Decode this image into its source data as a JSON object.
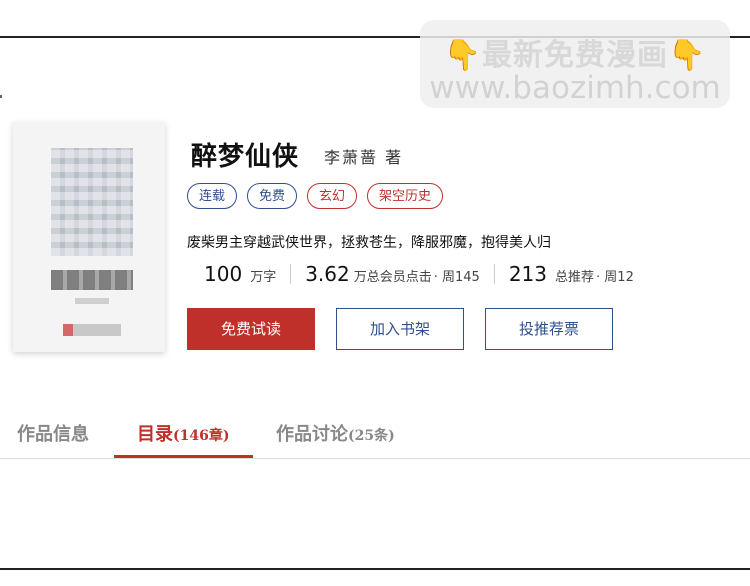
{
  "watermark": {
    "hand_left": "👇",
    "text": "最新免费漫画",
    "hand_right": "👇",
    "url": "www.baozimh.com"
  },
  "book": {
    "title": "醉梦仙侠",
    "author": "李萧蔷 著",
    "tags": [
      {
        "label": "连载",
        "color": "#2f4f8f"
      },
      {
        "label": "免费",
        "color": "#2f4f8f"
      },
      {
        "label": "玄幻",
        "color": "#c0302a"
      },
      {
        "label": "架空历史",
        "color": "#c0302a"
      }
    ],
    "intro": "废柴男主穿越武侠世界，拯救苍生，降服邪魔，抱得美人归"
  },
  "stats": {
    "words_value": "100",
    "words_unit": "万字",
    "clicks_value": "3.62",
    "clicks_unit": "万总会员点击",
    "clicks_week": "· 周145",
    "recommend_value": "213",
    "recommend_unit": "总推荐",
    "recommend_week": "· 周12"
  },
  "buttons": {
    "read": "免费试读",
    "shelf": "加入书架",
    "vote": "投推荐票"
  },
  "tabs": [
    {
      "label": "作品信息",
      "count": ""
    },
    {
      "label": "目录",
      "count": "(146章)"
    },
    {
      "label": "作品讨论",
      "count": "(25条)"
    }
  ],
  "colors": {
    "accent_red": "#c0302a",
    "accent_blue": "#2f4f8f"
  }
}
